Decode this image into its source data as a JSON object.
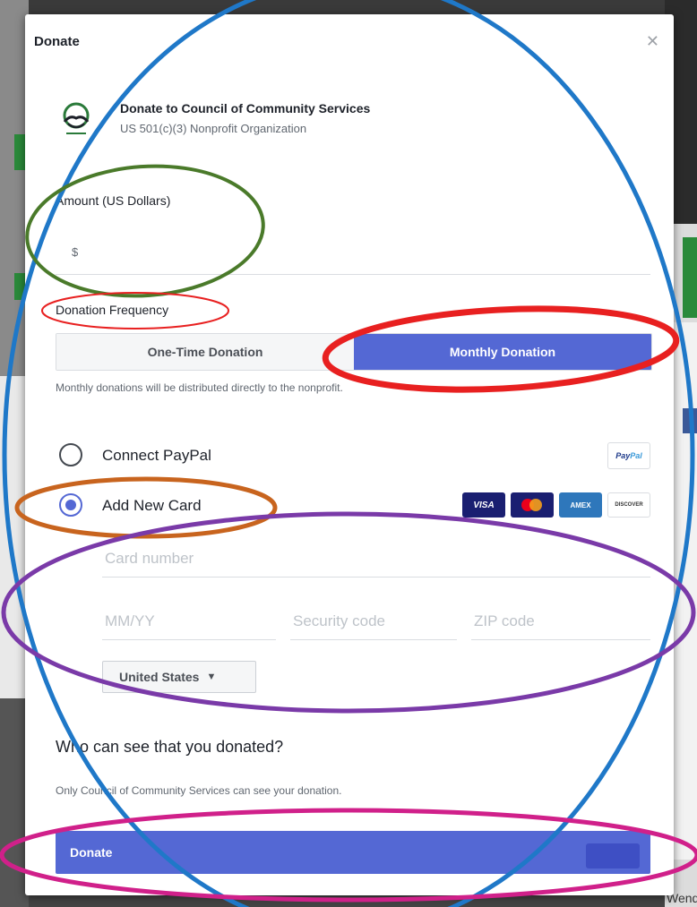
{
  "dialog": {
    "title": "Donate",
    "close_icon": "close-icon"
  },
  "organization": {
    "name": "Donate to Council of Community Services",
    "subtitle": "US 501(c)(3) Nonprofit Organization",
    "logo_icon": "handshake-logo-icon"
  },
  "amount": {
    "label": "Amount (US Dollars)",
    "currency_symbol": "$",
    "value": ""
  },
  "frequency": {
    "label": "Donation Frequency",
    "options": [
      "One-Time Donation",
      "Monthly Donation"
    ],
    "selected": "Monthly Donation",
    "note": "Monthly donations will be distributed directly to the nonprofit."
  },
  "payment": {
    "paypal_label": "Connect PayPal",
    "paypal_badge": [
      "Pay",
      "Pal"
    ],
    "card_label": "Add New Card",
    "selected": "Add New Card",
    "card_brands": [
      "VISA",
      "AMEX",
      "DISCOVER"
    ],
    "card_number_placeholder": "Card number",
    "expiry_placeholder": "MM/YY",
    "security_placeholder": "Security code",
    "zip_placeholder": "ZIP code",
    "country": "United States"
  },
  "visibility": {
    "question": "Who can see that you donated?",
    "note": "Only Council of Community Services can see your donation."
  },
  "footer": {
    "donate_label": "Donate"
  },
  "background": {
    "partial_text": "Wendy"
  },
  "colors": {
    "accent": "#5468d4",
    "annotation_blue": "#1f78c8",
    "annotation_green": "#4a7a2a",
    "annotation_red": "#e82020",
    "annotation_orange": "#c8641e",
    "annotation_purple": "#7a3aa8",
    "annotation_magenta": "#d0208a"
  }
}
